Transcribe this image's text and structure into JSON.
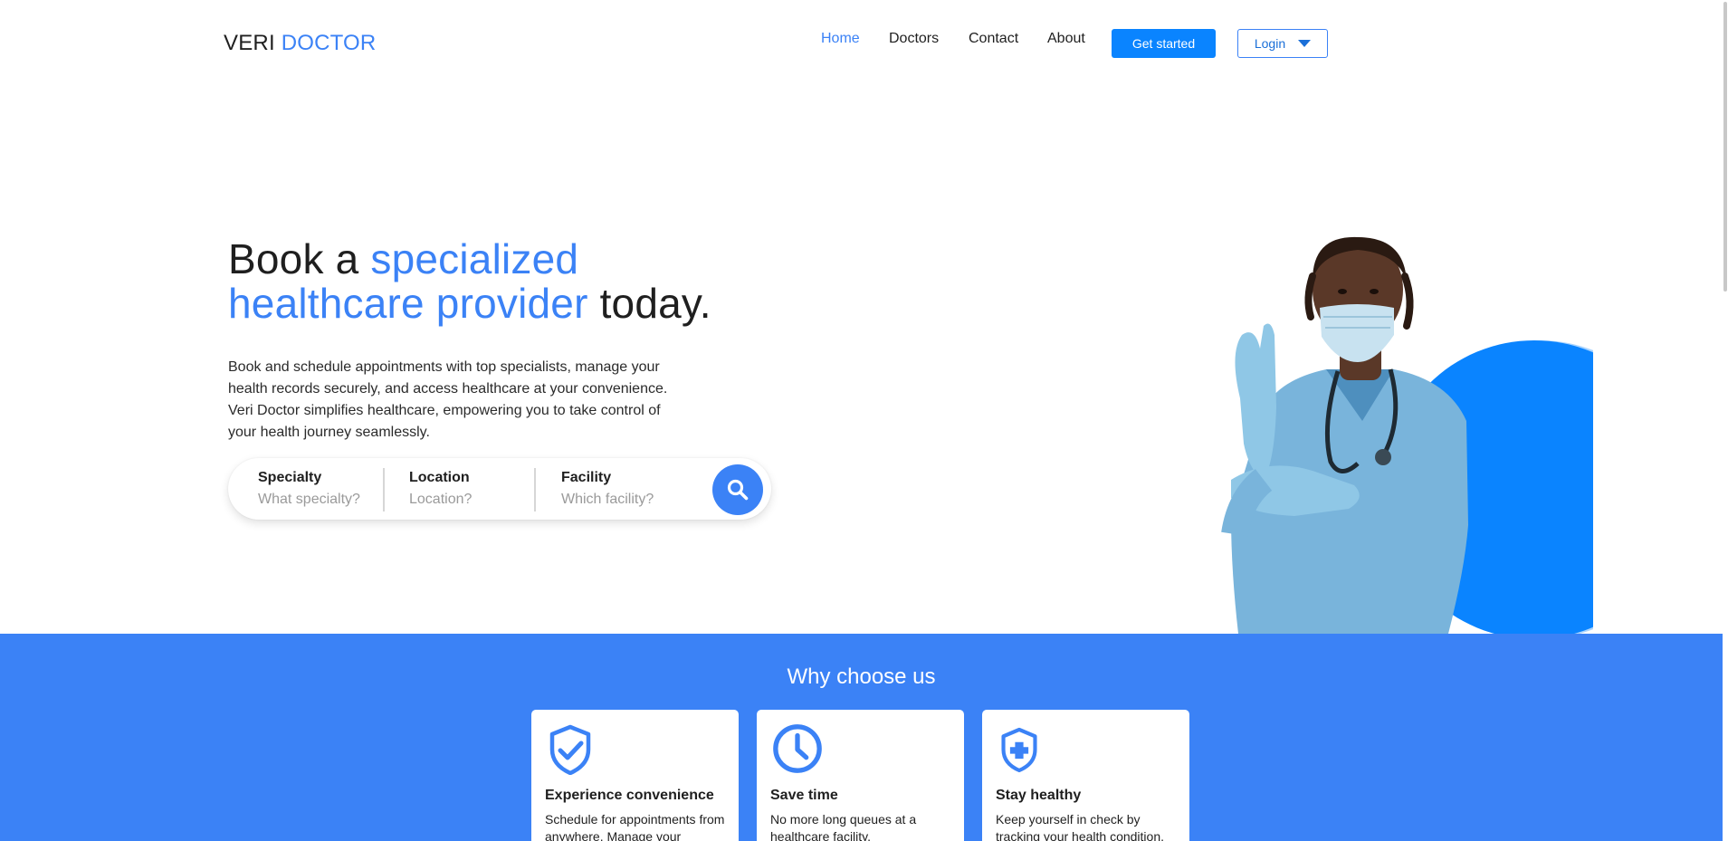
{
  "brand": {
    "part1": "VERI",
    "part2": "DOCTOR"
  },
  "nav": {
    "links": [
      {
        "label": "Home",
        "active": true
      },
      {
        "label": "Doctors",
        "active": false
      },
      {
        "label": "Contact",
        "active": false
      },
      {
        "label": "About",
        "active": false
      }
    ],
    "get_started_label": "Get started",
    "login_label": "Login"
  },
  "hero": {
    "title_part1": "Book a ",
    "title_highlight1": "specialized",
    "title_highlight2": "healthcare provider",
    "title_part2": " today.",
    "description": "Book and schedule appointments with top specialists, manage your health records securely, and access healthcare at your convenience. Veri Doctor simplifies healthcare, empowering you to take control of your health journey seamlessly."
  },
  "search": {
    "fields": [
      {
        "label": "Specialty",
        "placeholder": "What specialty?"
      },
      {
        "label": "Location",
        "placeholder": "Location?"
      },
      {
        "label": "Facility",
        "placeholder": "Which facility?"
      }
    ]
  },
  "why": {
    "title": "Why choose us",
    "cards": [
      {
        "icon": "shield-check-icon",
        "title": "Experience convenience",
        "text": "Schedule for appointments from anywhere. Manage your"
      },
      {
        "icon": "clock-icon",
        "title": "Save time",
        "text": "No more long queues at a healthcare facility."
      },
      {
        "icon": "shield-plus-icon",
        "title": "Stay healthy",
        "text": "Keep yourself in check by tracking your health condition."
      }
    ]
  },
  "colors": {
    "accent": "#3b82f6",
    "button_blue": "#0a84ff",
    "text": "#1f1f1f"
  }
}
